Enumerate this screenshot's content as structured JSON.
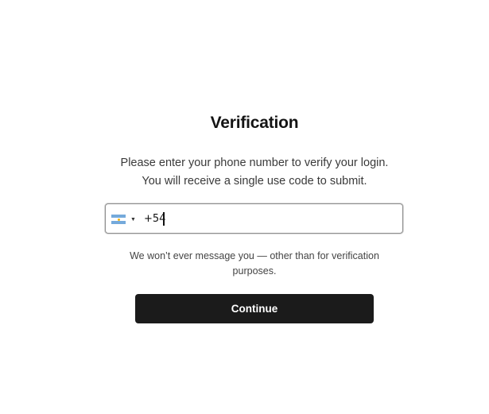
{
  "page": {
    "title": "Verification",
    "subtitle_line1": "Please enter your phone number to verify your login.",
    "subtitle_line2": "You will receive a single use code to submit."
  },
  "phone": {
    "country_flag": "argentina-flag-icon",
    "value": "+54",
    "colors": {
      "flag_blue": "#75aadb",
      "flag_sun": "#f6b40e"
    }
  },
  "note": {
    "line1": "We won’t ever message you — other than for verification",
    "line2": "purposes."
  },
  "actions": {
    "continue_label": "Continue",
    "button_color": "#1b1b1b"
  }
}
